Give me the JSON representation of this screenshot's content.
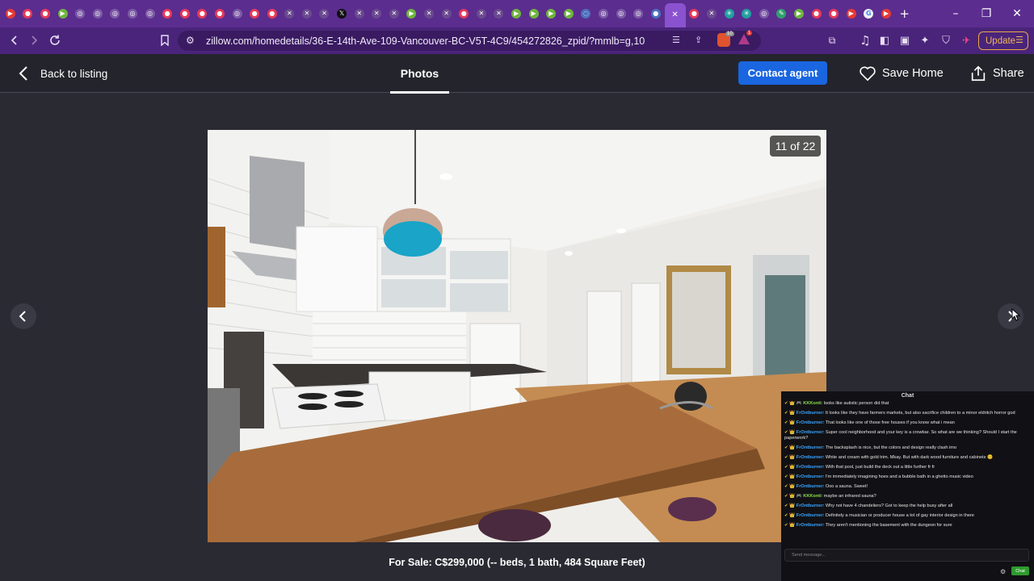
{
  "browser": {
    "tab_favicons": [
      {
        "icon": "youtube-icon",
        "color": "#e53935",
        "glyph": "▶"
      },
      {
        "icon": "media-icon",
        "color": "#e53959",
        "glyph": "●"
      },
      {
        "icon": "media-icon",
        "color": "#e53959",
        "glyph": "●"
      },
      {
        "icon": "play-icon",
        "color": "#6fb43f",
        "glyph": "▶"
      },
      {
        "icon": "chatgpt-icon",
        "color": "#7c5aa6",
        "glyph": "◎"
      },
      {
        "icon": "chatgpt-icon",
        "color": "#7c5aa6",
        "glyph": "◎"
      },
      {
        "icon": "chatgpt-icon",
        "color": "#7c5aa6",
        "glyph": "◎"
      },
      {
        "icon": "chatgpt-icon",
        "color": "#7c5aa6",
        "glyph": "◎"
      },
      {
        "icon": "chatgpt-icon",
        "color": "#7c5aa6",
        "glyph": "◎"
      },
      {
        "icon": "media-icon",
        "color": "#e53959",
        "glyph": "●"
      },
      {
        "icon": "media-icon",
        "color": "#e53959",
        "glyph": "●"
      },
      {
        "icon": "media-icon",
        "color": "#e53959",
        "glyph": "●"
      },
      {
        "icon": "media-icon",
        "color": "#e53959",
        "glyph": "●"
      },
      {
        "icon": "chatgpt-icon",
        "color": "#7c5aa6",
        "glyph": "◎"
      },
      {
        "icon": "media-icon",
        "color": "#e53959",
        "glyph": "●"
      },
      {
        "icon": "media-icon",
        "color": "#e53959",
        "glyph": "●"
      },
      {
        "icon": "x-icon",
        "color": "#6a4a8e",
        "glyph": "✕"
      },
      {
        "icon": "x-icon",
        "color": "#6a4a8e",
        "glyph": "✕"
      },
      {
        "icon": "x-icon",
        "color": "#6a4a8e",
        "glyph": "✕"
      },
      {
        "icon": "x-logo-icon",
        "color": "#111111",
        "glyph": "𝕏"
      },
      {
        "icon": "x-icon",
        "color": "#6a4a8e",
        "glyph": "✕"
      },
      {
        "icon": "x-icon",
        "color": "#6a4a8e",
        "glyph": "✕"
      },
      {
        "icon": "x-icon",
        "color": "#6a4a8e",
        "glyph": "✕"
      },
      {
        "icon": "play-icon",
        "color": "#6fb43f",
        "glyph": "▶"
      },
      {
        "icon": "x-icon",
        "color": "#6a4a8e",
        "glyph": "✕"
      },
      {
        "icon": "x-icon",
        "color": "#6a4a8e",
        "glyph": "✕"
      },
      {
        "icon": "media-icon",
        "color": "#e53959",
        "glyph": "●"
      },
      {
        "icon": "x-icon",
        "color": "#6a4a8e",
        "glyph": "✕"
      },
      {
        "icon": "x-icon",
        "color": "#6a4a8e",
        "glyph": "✕"
      },
      {
        "icon": "play-icon",
        "color": "#6fb43f",
        "glyph": "▶"
      },
      {
        "icon": "play-icon",
        "color": "#6fb43f",
        "glyph": "▶"
      },
      {
        "icon": "play-icon",
        "color": "#6fb43f",
        "glyph": "▶"
      },
      {
        "icon": "play-icon",
        "color": "#6fb43f",
        "glyph": "▶"
      },
      {
        "icon": "loading-icon",
        "color": "#4d6fbf",
        "glyph": "◌"
      },
      {
        "icon": "chatgpt-icon",
        "color": "#7c5aa6",
        "glyph": "◎"
      },
      {
        "icon": "chatgpt-icon",
        "color": "#7c5aa6",
        "glyph": "◎"
      },
      {
        "icon": "chatgpt-icon",
        "color": "#7c5aa6",
        "glyph": "◎"
      },
      {
        "icon": "globe-icon",
        "color": "#4d6fbf",
        "glyph": "●"
      },
      {
        "icon": "close-tab-icon",
        "color": "#8a52cf",
        "glyph": "✕",
        "active": true
      },
      {
        "icon": "media-icon",
        "color": "#e53959",
        "glyph": "●"
      },
      {
        "icon": "x-icon",
        "color": "#6a4a8e",
        "glyph": "✕"
      },
      {
        "icon": "perplexity-icon",
        "color": "#20a0a0",
        "glyph": "✳"
      },
      {
        "icon": "perplexity-icon",
        "color": "#20a0a0",
        "glyph": "✳"
      },
      {
        "icon": "chatgpt-icon",
        "color": "#7c5aa6",
        "glyph": "◎"
      },
      {
        "icon": "brush-icon",
        "color": "#2fa06e",
        "glyph": "✎"
      },
      {
        "icon": "play-icon",
        "color": "#6fb43f",
        "glyph": "▶"
      },
      {
        "icon": "media-icon",
        "color": "#e53959",
        "glyph": "●"
      },
      {
        "icon": "media-icon",
        "color": "#e53959",
        "glyph": "●"
      },
      {
        "icon": "youtube-icon",
        "color": "#e53935",
        "glyph": "▶"
      },
      {
        "icon": "google-icon",
        "color": "#f1f1f1",
        "glyph": "G"
      },
      {
        "icon": "youtube-icon",
        "color": "#e53935",
        "glyph": "▶"
      }
    ],
    "new_tab_glyph": "+",
    "url": "zillow.com/homedetails/36-E-14th-Ave-109-Vancouver-BC-V5T-4C9/454272826_zpid/?mmlb=g,10",
    "update_label": "Update",
    "shield_badge": "10",
    "alert_badge": "1"
  },
  "header": {
    "back_label": "Back to listing",
    "photos_tab": "Photos",
    "contact_label": "Contact agent",
    "save_label": "Save Home",
    "share_label": "Share"
  },
  "gallery": {
    "counter": "11 of 22",
    "caption": "For Sale: C$299,000 (-- beds, 1 bath, 484 Square Feet)"
  },
  "chat": {
    "title": "Chat",
    "messages": [
      {
        "badges": "✔ 👑 🎮",
        "user": "KKKonti",
        "user_color": "green",
        "text": "looks like autistic person did that"
      },
      {
        "badges": "✔ 👑",
        "user": "FrOntburner",
        "user_color": "blue",
        "text": "It looks like they have farmers markets, but also sacrifice children to a minor eldritch horror god"
      },
      {
        "badges": "✔ 👑",
        "user": "FrOntburner",
        "user_color": "blue",
        "text": "That looks like one of those free houses if you know what i mean"
      },
      {
        "badges": "✔ 👑",
        "user": "FrOntburner",
        "user_color": "blue",
        "text": "Super cool neighborhood and your key is a crowbar. So what are we thinking? Should I start the paperwork?"
      },
      {
        "badges": "✔ 👑",
        "user": "FrOntburner",
        "user_color": "blue",
        "text": "The backsplash is nice, but the colors and design really clash imo"
      },
      {
        "badges": "✔ 👑",
        "user": "FrOntburner",
        "user_color": "blue",
        "text": "White and cream with gold trim. Mkay. But with dark wood furniture and cabinets 😊"
      },
      {
        "badges": "✔ 👑",
        "user": "FrOntburner",
        "user_color": "blue",
        "text": "With that pool, just build the deck out a little further fr fr"
      },
      {
        "badges": "✔ 👑",
        "user": "FrOntburner",
        "user_color": "blue",
        "text": "I'm immediately imagining hoes and a bubble bath in a ghetto music video"
      },
      {
        "badges": "✔ 👑",
        "user": "FrOntburner",
        "user_color": "blue",
        "text": "Ooo a sauna. Sweet!"
      },
      {
        "badges": "✔ 👑 🎮",
        "user": "KKKonti",
        "user_color": "green",
        "text": "maybe an infrared sauna?"
      },
      {
        "badges": "✔ 👑",
        "user": "FrOntburner",
        "user_color": "blue",
        "text": "Why not have 4 chandeliers? Got to keep the help busy after all"
      },
      {
        "badges": "✔ 👑",
        "user": "FrOntburner",
        "user_color": "blue",
        "text": "Definitely a musician or producer house a lot of gay interior design in there"
      },
      {
        "badges": "✔ 👑",
        "user": "FrOntburner",
        "user_color": "blue",
        "text": "They aren't mentioning the basement with the dungeon for sure"
      }
    ],
    "input_placeholder": "Send message...",
    "send_label": "Chat"
  }
}
